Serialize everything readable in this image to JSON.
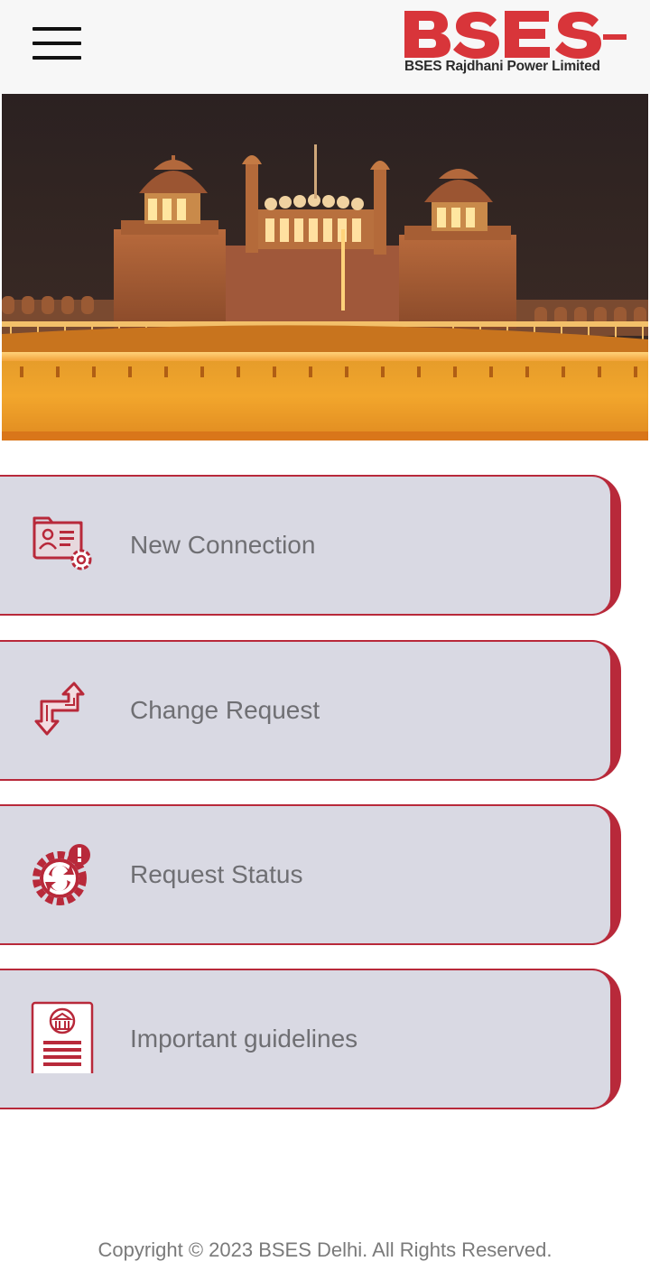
{
  "header": {
    "menu_icon": "hamburger-menu-icon",
    "logo_text": "BSES",
    "logo_subtitle": "BSES Rajdhani Power Limited",
    "brand_color": "#d8353a"
  },
  "hero": {
    "image": "red-fort-night-photo"
  },
  "menu": {
    "items": [
      {
        "label": "New Connection",
        "icon": "new-connection-icon"
      },
      {
        "label": "Change Request",
        "icon": "change-request-icon"
      },
      {
        "label": "Request Status",
        "icon": "request-status-icon"
      },
      {
        "label": "Important guidelines",
        "icon": "guidelines-icon"
      }
    ],
    "card_bg": "#d9d9e3",
    "accent_color": "#b8293a"
  },
  "footer": {
    "copyright": "Copyright © 2023 BSES Delhi. All Rights Reserved."
  }
}
